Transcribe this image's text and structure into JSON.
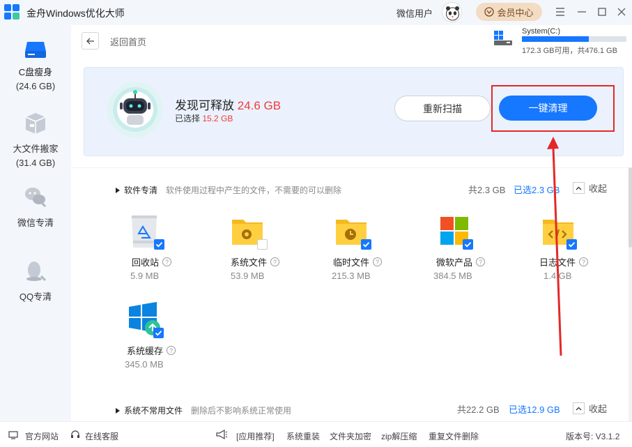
{
  "app": {
    "title": "金舟Windows优化大师",
    "user_label": "微信用户",
    "vip_label": "会员中心"
  },
  "sidebar": {
    "items": [
      {
        "label": "C盘瘦身",
        "sub": "(24.6 GB)"
      },
      {
        "label": "大文件搬家",
        "sub": "(31.4 GB)"
      },
      {
        "label": "微信专清",
        "sub": ""
      },
      {
        "label": "QQ专清",
        "sub": ""
      }
    ]
  },
  "header": {
    "back_label": "返回首页"
  },
  "disk": {
    "name": "System(C:)",
    "info": "172.3 GB可用，共476.1 GB",
    "used_fraction": 0.64
  },
  "summary": {
    "found_prefix": "发现可释放",
    "found_value": "24.6 GB",
    "selected_prefix": "已选择",
    "selected_value": "15.2 GB",
    "rescan_label": "重新扫描",
    "clean_label": "一键清理"
  },
  "sections": [
    {
      "title": "软件专清",
      "desc": "软件使用过程中产生的文件，不需要的可以删除",
      "total": "共2.3 GB",
      "selected": "已选2.3 GB",
      "collapse_label": "收起",
      "items": [
        {
          "name": "回收站",
          "size": "5.9 MB",
          "icon": "recycle-bin-icon",
          "checked": true
        },
        {
          "name": "系统文件",
          "size": "53.9 MB",
          "icon": "folder-gear-icon",
          "checked": false
        },
        {
          "name": "临时文件",
          "size": "215.3 MB",
          "icon": "folder-clock-icon",
          "checked": true
        },
        {
          "name": "微软产品",
          "size": "384.5 MB",
          "icon": "microsoft-logo-icon",
          "checked": true
        },
        {
          "name": "日志文件",
          "size": "1.4 GB",
          "icon": "folder-code-icon",
          "checked": true
        },
        {
          "name": "系统缓存",
          "size": "345.0 MB",
          "icon": "windows-cache-icon",
          "checked": true
        }
      ]
    },
    {
      "title": "系统不常用文件",
      "desc": "删除后不影响系统正常使用",
      "total": "共22.2 GB",
      "selected": "已选12.9 GB",
      "collapse_label": "收起"
    }
  ],
  "bottom": {
    "official_site": "官方网站",
    "online_service": "在线客服",
    "app_recommend": "[应用推荐]",
    "links": [
      "系统重装",
      "文件夹加密",
      "zip解压缩",
      "重复文件删除"
    ],
    "version": "版本号: V3.1.2"
  },
  "colors": {
    "accent": "#1677ff",
    "danger": "#f23a3a",
    "vip_bg": "#f3dcc4"
  }
}
